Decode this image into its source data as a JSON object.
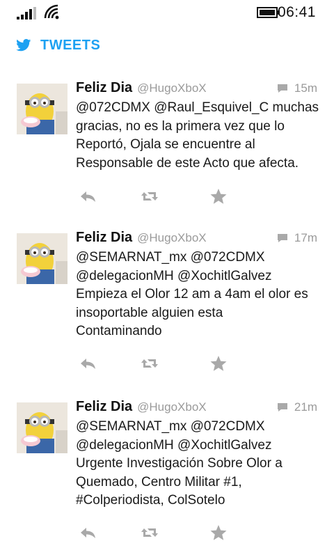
{
  "status_bar": {
    "time": "06:41",
    "signal_icon": "signal-bars-icon",
    "wifi_icon": "wifi-icon",
    "battery_icon": "battery-icon"
  },
  "header": {
    "title": "TWEETS",
    "icon": "twitter-bird-icon",
    "accent_color": "#1da1f2"
  },
  "tweets": [
    {
      "author": "Feliz Dia",
      "handle": "@HugoXboX",
      "time": "15m",
      "text_lines": [
        "@072CDMX @Raul_Esquivel_C muchas",
        "gracias, no es la primera vez que lo",
        "Reportó, Ojala se encuentre al",
        "Responsable de este Acto que afecta."
      ]
    },
    {
      "author": "Feliz Dia",
      "handle": "@HugoXboX",
      "time": "17m",
      "text_lines": [
        "@SEMARNAT_mx @072CDMX",
        "@delegacionMH @XochitlGalvez",
        "Empieza el Olor 12 am a 4am el olor es",
        "insoportable alguien esta",
        "Contaminando"
      ]
    },
    {
      "author": "Feliz Dia",
      "handle": "@HugoXboX",
      "time": "21m",
      "text_lines": [
        "@SEMARNAT_mx @072CDMX",
        "@delegacionMH @XochitlGalvez",
        "Urgente Investigación Sobre Olor a",
        "Quemado, Centro Militar #1,",
        "#Colperiodista, ColSotelo"
      ]
    }
  ],
  "action_icons": [
    "reply-icon",
    "retweet-icon",
    "favorite-star-icon"
  ],
  "colors": {
    "muted_text": "#9a9a9a",
    "icon_gray": "#a9a9a9"
  }
}
